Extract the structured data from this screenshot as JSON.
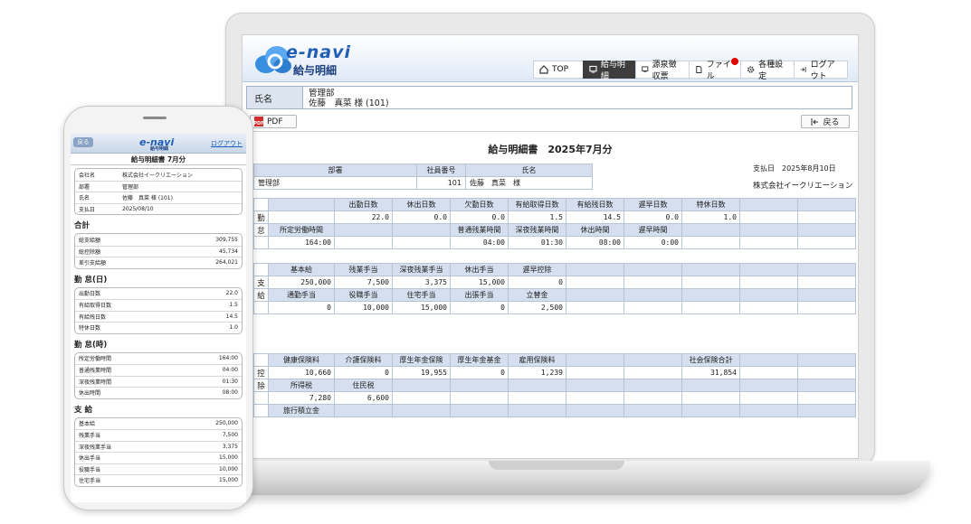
{
  "header": {
    "brand": "e-navi",
    "brand_sub": "給与明細",
    "nav": [
      {
        "label": "TOP",
        "icon": "home-icon"
      },
      {
        "label": "給与明細",
        "icon": "monitor-icon"
      },
      {
        "label": "源泉徴収票",
        "icon": "monitor-icon"
      },
      {
        "label": "ファイル",
        "icon": "file-icon"
      },
      {
        "label": "各種設定",
        "icon": "gear-icon"
      },
      {
        "label": "ログアウト",
        "icon": "logout-icon"
      }
    ]
  },
  "name_row": {
    "label": "氏名",
    "dept": "管理部",
    "name": "佐藤　真菜 様 (101)"
  },
  "toolbar": {
    "pdf": "PDF",
    "back": "戻る"
  },
  "doc": {
    "title": "給与明細書　2025年7月分",
    "paydate": "支払日　2025年8月10日",
    "company": "株式会社イークリエーション",
    "info_headers": [
      "部署",
      "社員番号",
      "氏名"
    ],
    "info_values": [
      "管理部",
      "101",
      "佐藤　真菜　様"
    ]
  },
  "kintai": {
    "side": [
      "勤",
      "怠"
    ],
    "h1": [
      "",
      "出勤日数",
      "休出日数",
      "欠勤日数",
      "有給取得日数",
      "有給残日数",
      "遅早日数",
      "特休日数",
      "",
      ""
    ],
    "v1": [
      "",
      "22.0",
      "0.0",
      "0.0",
      "1.5",
      "14.5",
      "0.0",
      "1.0",
      "",
      ""
    ],
    "h2": [
      "所定労働時間",
      "",
      "",
      "普通残業時間",
      "深夜残業時間",
      "休出時間",
      "遅早時間",
      "",
      "",
      ""
    ],
    "v2": [
      "164:00",
      "",
      "",
      "04:00",
      "01:30",
      "08:00",
      "0:00",
      "",
      "",
      ""
    ]
  },
  "shikyu": {
    "side": [
      "支",
      "給"
    ],
    "h1": [
      "基本給",
      "残業手当",
      "深夜残業手当",
      "休出手当",
      "遅早控除",
      "",
      "",
      "",
      "",
      ""
    ],
    "v1": [
      "250,000",
      "7,500",
      "3,375",
      "15,000",
      "0",
      "",
      "",
      "",
      "",
      ""
    ],
    "h2": [
      "通勤手当",
      "役職手当",
      "住宅手当",
      "出張手当",
      "立替金",
      "",
      "",
      "",
      "",
      ""
    ],
    "v2": [
      "0",
      "10,000",
      "15,000",
      "0",
      "2,500",
      "",
      "",
      "",
      "",
      ""
    ]
  },
  "kojo": {
    "side": [
      "控",
      "除"
    ],
    "h1": [
      "健康保険料",
      "介護保険料",
      "厚生年金保険",
      "厚生年金基金",
      "雇用保険料",
      "",
      "",
      "社会保険合計",
      "",
      ""
    ],
    "v1": [
      "10,660",
      "0",
      "19,955",
      "0",
      "1,239",
      "",
      "",
      "31,854",
      "",
      ""
    ],
    "h2": [
      "所得税",
      "住民税",
      "",
      "",
      "",
      "",
      "",
      "",
      "",
      ""
    ],
    "v2": [
      "7,280",
      "6,600",
      "",
      "",
      "",
      "",
      "",
      "",
      "",
      ""
    ],
    "h3": [
      "旅行積立金",
      "",
      "",
      "",
      "",
      "",
      "",
      "",
      "",
      ""
    ]
  },
  "phone": {
    "back": "戻る",
    "brand": "e-navi",
    "brand_sub": "給与明細",
    "logout": "ログアウト",
    "title": "給与明細書 7月分",
    "info": [
      {
        "k": "会社名",
        "v": "株式会社イークリエーション"
      },
      {
        "k": "部署",
        "v": "管理部"
      },
      {
        "k": "氏名",
        "v": "佐藤　真菜 様 (101)"
      },
      {
        "k": "支払日",
        "v": "2025/08/10"
      }
    ],
    "sec_total": "合計",
    "total": [
      {
        "k": "総支給額",
        "v": "309,755"
      },
      {
        "k": "総控除額",
        "v": "45,734"
      },
      {
        "k": "差引支給額",
        "v": "264,021"
      }
    ],
    "sec_days": "勤 怠(日)",
    "days": [
      {
        "k": "出勤日数",
        "v": "22.0"
      },
      {
        "k": "有給取得日数",
        "v": "1.5"
      },
      {
        "k": "有給残日数",
        "v": "14.5"
      },
      {
        "k": "特休日数",
        "v": "1.0"
      }
    ],
    "sec_hours": "勤 怠(時)",
    "hours": [
      {
        "k": "所定労働時間",
        "v": "164:00"
      },
      {
        "k": "普通残業時間",
        "v": "04:00"
      },
      {
        "k": "深夜残業時間",
        "v": "01:30"
      },
      {
        "k": "休出時間",
        "v": "08:00"
      }
    ],
    "sec_pay": "支 給",
    "pay": [
      {
        "k": "基本給",
        "v": "250,000"
      },
      {
        "k": "残業手当",
        "v": "7,500"
      },
      {
        "k": "深夜残業手当",
        "v": "3,375"
      },
      {
        "k": "休出手当",
        "v": "15,000"
      },
      {
        "k": "役職手当",
        "v": "10,000"
      },
      {
        "k": "住宅手当",
        "v": "15,000"
      }
    ]
  }
}
